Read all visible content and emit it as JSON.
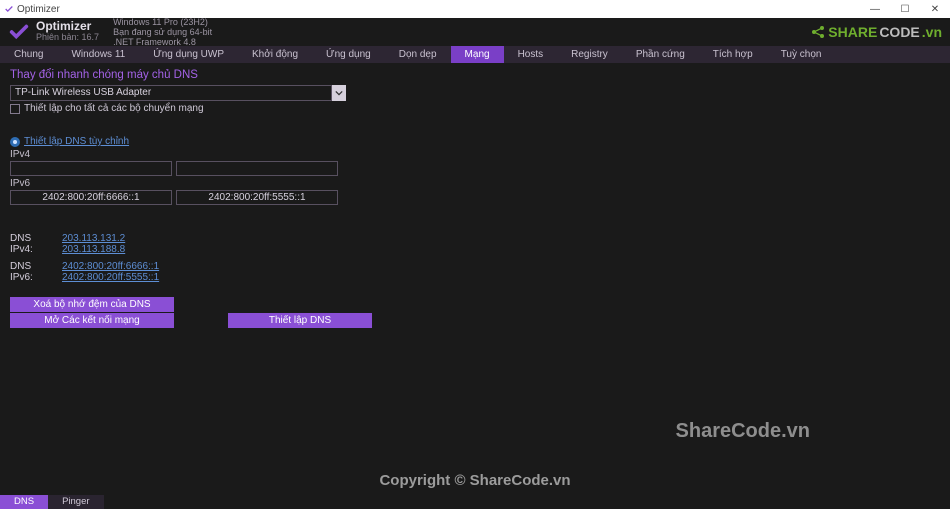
{
  "titlebar": {
    "title": "Optimizer"
  },
  "header": {
    "app_name": "Optimizer",
    "version": "Phiên bản: 16.7",
    "sys_line1": "Windows 11 Pro (23H2)",
    "sys_line2": "Bạn đang sử dụng 64-bit",
    "sys_line3": ".NET Framework 4.8",
    "brand_part1": "SHARE",
    "brand_part2": "CODE",
    "brand_part3": ".vn"
  },
  "tabs": [
    "Chung",
    "Windows 11",
    "Ứng dụng UWP",
    "Khởi động",
    "Ứng dụng",
    "Dọn dẹp",
    "Mạng",
    "Hosts",
    "Registry",
    "Phần cứng",
    "Tích hợp",
    "Tuỳ chọn"
  ],
  "active_tab_index": 6,
  "section": {
    "title": "Thay đổi nhanh chóng máy chủ DNS"
  },
  "adapter": {
    "selected": "TP-Link Wireless USB Adapter",
    "all_adapters_label": "Thiết lập cho tất cả các bộ chuyển mạng"
  },
  "custom_dns": {
    "radio_label": "Thiết lập DNS tùy chỉnh",
    "ipv4_label": "IPv4",
    "ipv4_a": "",
    "ipv4_b": "",
    "ipv6_label": "IPv6",
    "ipv6_a": "2402:800:20ff:6666::1",
    "ipv6_b": "2402:800:20ff:5555::1"
  },
  "dns_current": {
    "ipv4_label": "DNS IPv4:",
    "ipv4_vals": [
      "203.113.131.2",
      "203.113.188.8"
    ],
    "ipv6_label": "DNS IPv6:",
    "ipv6_vals": [
      "2402:800:20ff:6666::1",
      "2402:800:20ff:5555::1"
    ]
  },
  "buttons": {
    "flush": "Xoá bộ nhớ đệm của DNS",
    "open_conn": "Mở Các kết nối mạng",
    "set_dns": "Thiết lập DNS"
  },
  "bottom_tabs": [
    "DNS",
    "Pinger"
  ],
  "bottom_active_index": 0,
  "watermark1": "ShareCode.vn",
  "watermark2": "Copyright © ShareCode.vn"
}
